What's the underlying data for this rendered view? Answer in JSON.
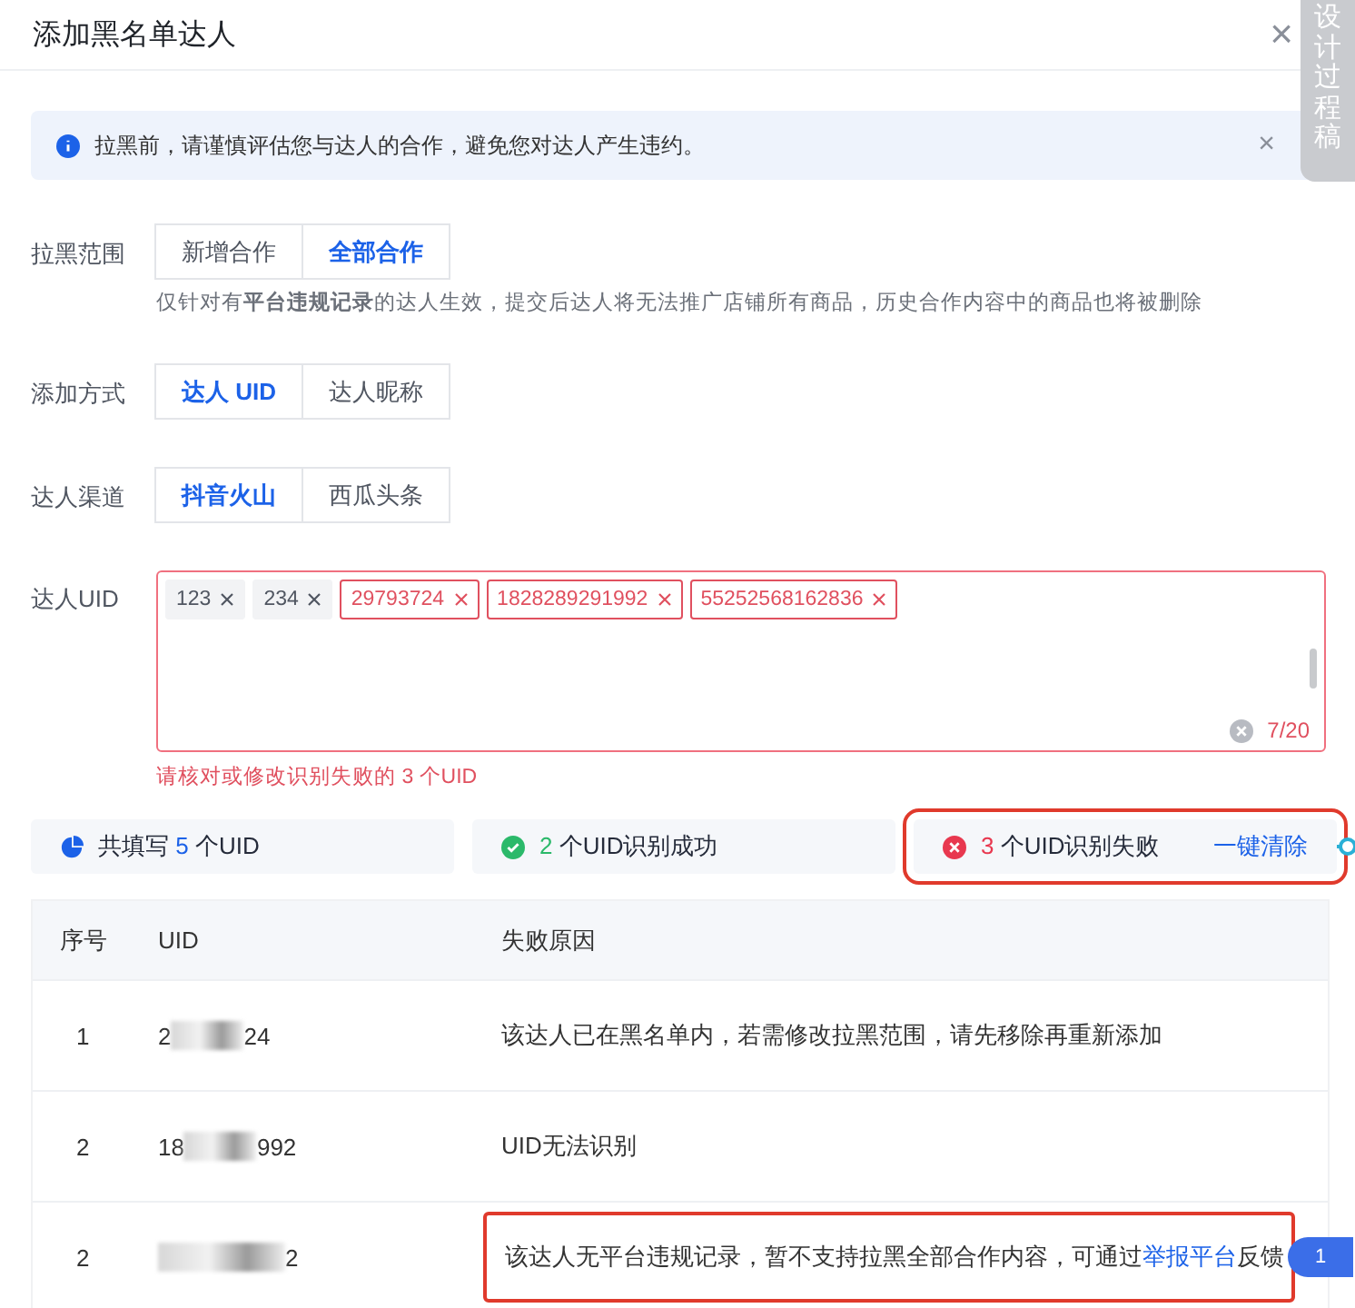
{
  "dialog": {
    "title": "添加黑名单达人",
    "close": "×"
  },
  "side_tab": {
    "label": "设计过程稿"
  },
  "alert": {
    "text": "拉黑前，请谨慎评估您与达人的合作，避免您对达人产生违约。",
    "close": "×"
  },
  "form": [
    {
      "label": "拉黑范围",
      "kind": "segmented",
      "options": [
        {
          "label": "新增合作",
          "selected": false
        },
        {
          "label": "全部合作",
          "selected": true
        }
      ],
      "hint": "仅针对有**平台违规记录**的达人生效，提交后达人将无法推广店铺所有商品，历史合作内容中的商品也将被删除"
    },
    {
      "label": "添加方式",
      "kind": "segmented",
      "options": [
        {
          "label": "达人 UID",
          "selected": true
        },
        {
          "label": "达人昵称",
          "selected": false
        }
      ]
    },
    {
      "label": "达人渠道",
      "kind": "segmented",
      "options": [
        {
          "label": "抖音火山",
          "selected": true
        },
        {
          "label": "西瓜头条",
          "selected": false
        }
      ]
    },
    {
      "label": "达人UID",
      "kind": "tags",
      "tags": [
        {
          "text": "123",
          "error": false
        },
        {
          "text": "234",
          "error": false
        },
        {
          "text": "29793724",
          "error": true
        },
        {
          "text": "1828289291992",
          "error": true
        },
        {
          "text": "55252568162836",
          "error": true
        }
      ],
      "counter": "7/20",
      "error": "请核对或修改识别失败的 3 个UID"
    }
  ],
  "summary": [
    {
      "kind": "total",
      "before": "共填写",
      "count": "5",
      "after": "个UID",
      "highlighted": false
    },
    {
      "kind": "success",
      "count": "2",
      "after": "个UID识别成功",
      "highlighted": false
    },
    {
      "kind": "fail",
      "count": "3",
      "after": "个UID识别失败",
      "action": "一键清除",
      "highlighted": true
    }
  ],
  "table": {
    "columns": [
      "序号",
      "UID",
      "失败原因"
    ],
    "rows": [
      {
        "index": "1",
        "uid_prefix": "2",
        "uid_suffix": "24",
        "reason": "该达人已在黑名单内，若需修改拉黑范围，请先移除再重新添加",
        "highlighted": false
      },
      {
        "index": "2",
        "uid_prefix": "18",
        "uid_suffix": "992",
        "reason": "UID无法识别",
        "highlighted": false
      },
      {
        "index": "2",
        "uid_suffix": "2",
        "reason": "该达人无平台违规记录，暂不支持拉黑全部合作内容，可通过",
        "link": "举报平台",
        "reason_after": "反馈",
        "highlighted": true,
        "badge": "1"
      }
    ]
  }
}
